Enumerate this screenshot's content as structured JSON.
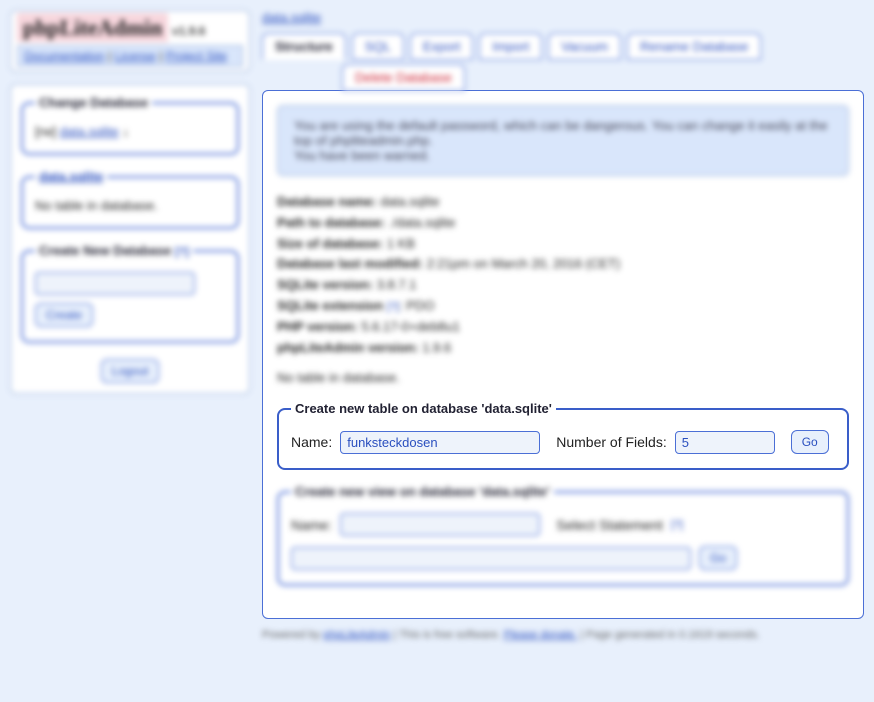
{
  "logo": {
    "title": "phpLiteAdmin",
    "version": "v1.9.6"
  },
  "nav": {
    "doc": "Documentation",
    "license": "License",
    "project": "Project Site"
  },
  "sidebar": {
    "change_db": {
      "legend": "Change Database",
      "prefix": "[rw]",
      "db": "data.sqlite",
      "suffix": "↓"
    },
    "db_section": {
      "legend": "data.sqlite",
      "msg": "No table in database."
    },
    "create_db": {
      "legend": "Create New Database",
      "sup": "[?]",
      "btn": "Create"
    },
    "logout": "Logout"
  },
  "breadcrumb": "data.sqlite",
  "tabs": {
    "structure": "Structure",
    "sql": "SQL",
    "export": "Export",
    "import": "Import",
    "vacuum": "Vacuum",
    "rename": "Rename Database",
    "delete": "Delete Database"
  },
  "warn": {
    "line1": "You are using the default password, which can be dangerous. You can change it easily at the top of phpliteadmin.php.",
    "line2": "You have been warned."
  },
  "info": {
    "dbname_l": "Database name:",
    "dbname_v": "data.sqlite",
    "path_l": "Path to database:",
    "path_v": "./data.sqlite",
    "size_l": "Size of database:",
    "size_v": "1 KB",
    "mod_l": "Database last modified:",
    "mod_v": "2:21pm on March 20, 2016 (CET)",
    "sqlitev_l": "SQLite version:",
    "sqlitev_v": "3.8.7.1",
    "ext_l": "SQLite extension",
    "ext_sup": "[?]",
    "ext_v": ": PDO",
    "php_l": "PHP version:",
    "php_v": "5.6.17-0+deb8u1",
    "app_l": "phpLiteAdmin version:",
    "app_v": "1.9.6"
  },
  "no_table": "No table in database.",
  "create_table": {
    "legend": "Create new table on database 'data.sqlite'",
    "name_l": "Name:",
    "name_v": "funksteckdosen",
    "fields_l": "Number of Fields:",
    "fields_v": "5",
    "go": "Go"
  },
  "create_view": {
    "legend": "Create new view on database 'data.sqlite'",
    "name_l": "Name:",
    "stmt_l": "Select Statement",
    "sup": "[?]",
    "go": "Go"
  },
  "footer": {
    "pre": "Powered by ",
    "app": "phpLiteAdmin",
    "mid": " | This is free software. ",
    "donate": "Please donate.",
    "post": " | Page generated in 0.1619 seconds."
  }
}
